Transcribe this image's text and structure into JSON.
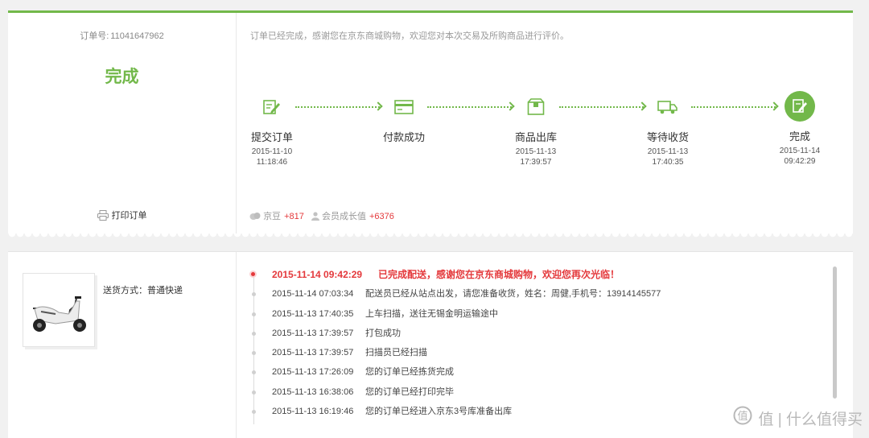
{
  "order": {
    "number_label": "订单号:",
    "number": "11041647962",
    "state": "完成",
    "print_label": "打印订单",
    "notice": "订单已经完成，感谢您在京东商城购物，欢迎您对本次交易及所购商品进行评价。"
  },
  "steps": [
    {
      "name": "提交订单",
      "date": "2015-11-10",
      "time": "11:18:46",
      "icon": "edit-order-icon"
    },
    {
      "name": "付款成功",
      "date": "",
      "time": "",
      "icon": "payment-card-icon"
    },
    {
      "name": "商品出库",
      "date": "2015-11-13",
      "time": "17:39:57",
      "icon": "package-box-icon"
    },
    {
      "name": "等待收货",
      "date": "2015-11-13",
      "time": "17:40:35",
      "icon": "delivery-truck-icon"
    },
    {
      "name": "完成",
      "date": "2015-11-14",
      "time": "09:42:29",
      "icon": "completed-icon"
    }
  ],
  "rewards": {
    "beans_label": "京豆",
    "beans_value": "+817",
    "growth_label": "会员成长值",
    "growth_value": "+6376"
  },
  "delivery": {
    "label": "送货方式：",
    "method": "普通快递"
  },
  "tracking": [
    {
      "time": "2015-11-14 09:42:29",
      "text": "已完成配送，感谢您在京东商城购物，欢迎您再次光临！"
    },
    {
      "time": "2015-11-14 07:03:34",
      "text": "配送员已经从站点出发，请您准备收货，姓名：周健,手机号：13914145577"
    },
    {
      "time": "2015-11-13 17:40:35",
      "text": "上车扫描，送往无锡金明运输途中"
    },
    {
      "time": "2015-11-13 17:39:57",
      "text": "打包成功"
    },
    {
      "time": "2015-11-13 17:39:57",
      "text": "扫描员已经扫描"
    },
    {
      "time": "2015-11-13 17:26:09",
      "text": "您的订单已经拣货完成"
    },
    {
      "time": "2015-11-13 16:38:06",
      "text": "您的订单已经打印完毕"
    },
    {
      "time": "2015-11-13 16:19:46",
      "text": "您的订单已经进入京东3号库准备出库"
    }
  ],
  "watermark": "值 | 什么值得买",
  "colors": {
    "accent": "#72b84a",
    "alert": "#e4393c"
  }
}
